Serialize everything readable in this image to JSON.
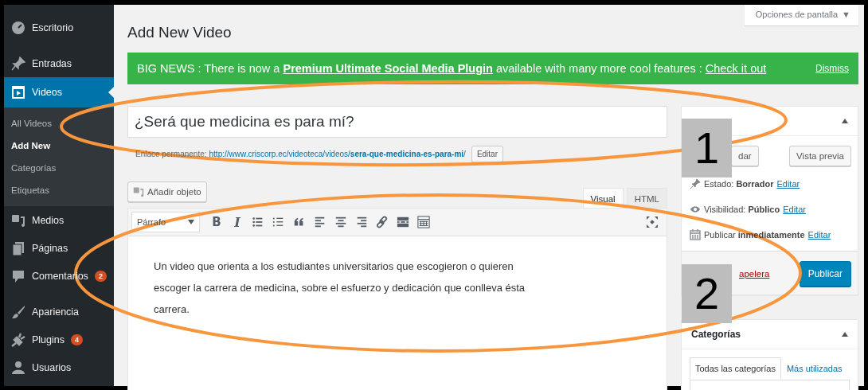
{
  "sidebar": {
    "items": [
      {
        "label": "Escritorio",
        "selected": false
      },
      {
        "label": "Entradas",
        "selected": false
      },
      {
        "label": "Videos",
        "selected": true,
        "children": [
          {
            "label": "All Videos",
            "selected": false
          },
          {
            "label": "Add New",
            "selected": true
          },
          {
            "label": "Categorías",
            "selected": false
          },
          {
            "label": "Etiquetas",
            "selected": false
          }
        ]
      },
      {
        "label": "Medios",
        "selected": false
      },
      {
        "label": "Páginas",
        "selected": false
      },
      {
        "label": "Comentarios",
        "selected": false,
        "badge": "2"
      },
      {
        "label": "Apariencia",
        "selected": false
      },
      {
        "label": "Plugins",
        "selected": false,
        "badge": "4"
      },
      {
        "label": "Usuarios",
        "selected": false
      }
    ]
  },
  "screen_options": {
    "label": "Opciones de pantalla",
    "caret": "▼"
  },
  "page_title": "Add New Video",
  "notice": {
    "text_1": "BIG NEWS : There is now a ",
    "link_1": "Premium Ultimate Social Media Plugin",
    "text_2": " available with many more cool features : ",
    "link_2": "Check it out",
    "dismiss": "Dismiss"
  },
  "post_title": "¿Será que medicina es para mí?",
  "permalink": {
    "label": "Enlace permanente:",
    "url": "http://www.criscorp.ec/videoteca/videos/",
    "slug": "sera-que-medicina-es-para-mi",
    "url_end": "/",
    "button": "Editar"
  },
  "add_media": "Añadir objeto",
  "editor_tabs": [
    {
      "label": "Visual",
      "selected": true
    },
    {
      "label": "HTML",
      "selected": false
    }
  ],
  "format_select": "Párrafo",
  "toolbar": [
    {
      "kind": "bold",
      "label": "B"
    },
    {
      "kind": "italic",
      "label": "I"
    },
    {
      "kind": "bullet-list"
    },
    {
      "kind": "numbered-list"
    },
    {
      "kind": "quote"
    },
    {
      "kind": "align-left"
    },
    {
      "kind": "align-center"
    },
    {
      "kind": "align-right"
    },
    {
      "kind": "link"
    },
    {
      "kind": "read-more"
    },
    {
      "kind": "toolbar-toggle"
    }
  ],
  "content": "Un video que orienta a los estudiantes universitarios que escogieron o quieren escoger la carrera de medicina, sobre el esfuerzo y dedicación que conlleva ésta carrera.",
  "publish_box": {
    "save_button": "dar",
    "preview_button": "Vista previa",
    "rows": [
      {
        "label": "Estado:",
        "value": "Borrador",
        "link": "Editar"
      },
      {
        "label": "Visibilidad:",
        "value": "Público",
        "link": "Editar"
      },
      {
        "label": "Publicar",
        "value": "inmediatamente",
        "link": "Editar"
      }
    ],
    "trash_link": "apelera",
    "publish_button": "Publicar"
  },
  "categories_box": {
    "title": "Categorías",
    "tabs": [
      {
        "label": "Todas las categorías",
        "selected": true
      },
      {
        "label": "Más utilizadas",
        "selected": false
      }
    ]
  },
  "annotations": [
    {
      "number": "1"
    },
    {
      "number": "2"
    }
  ]
}
